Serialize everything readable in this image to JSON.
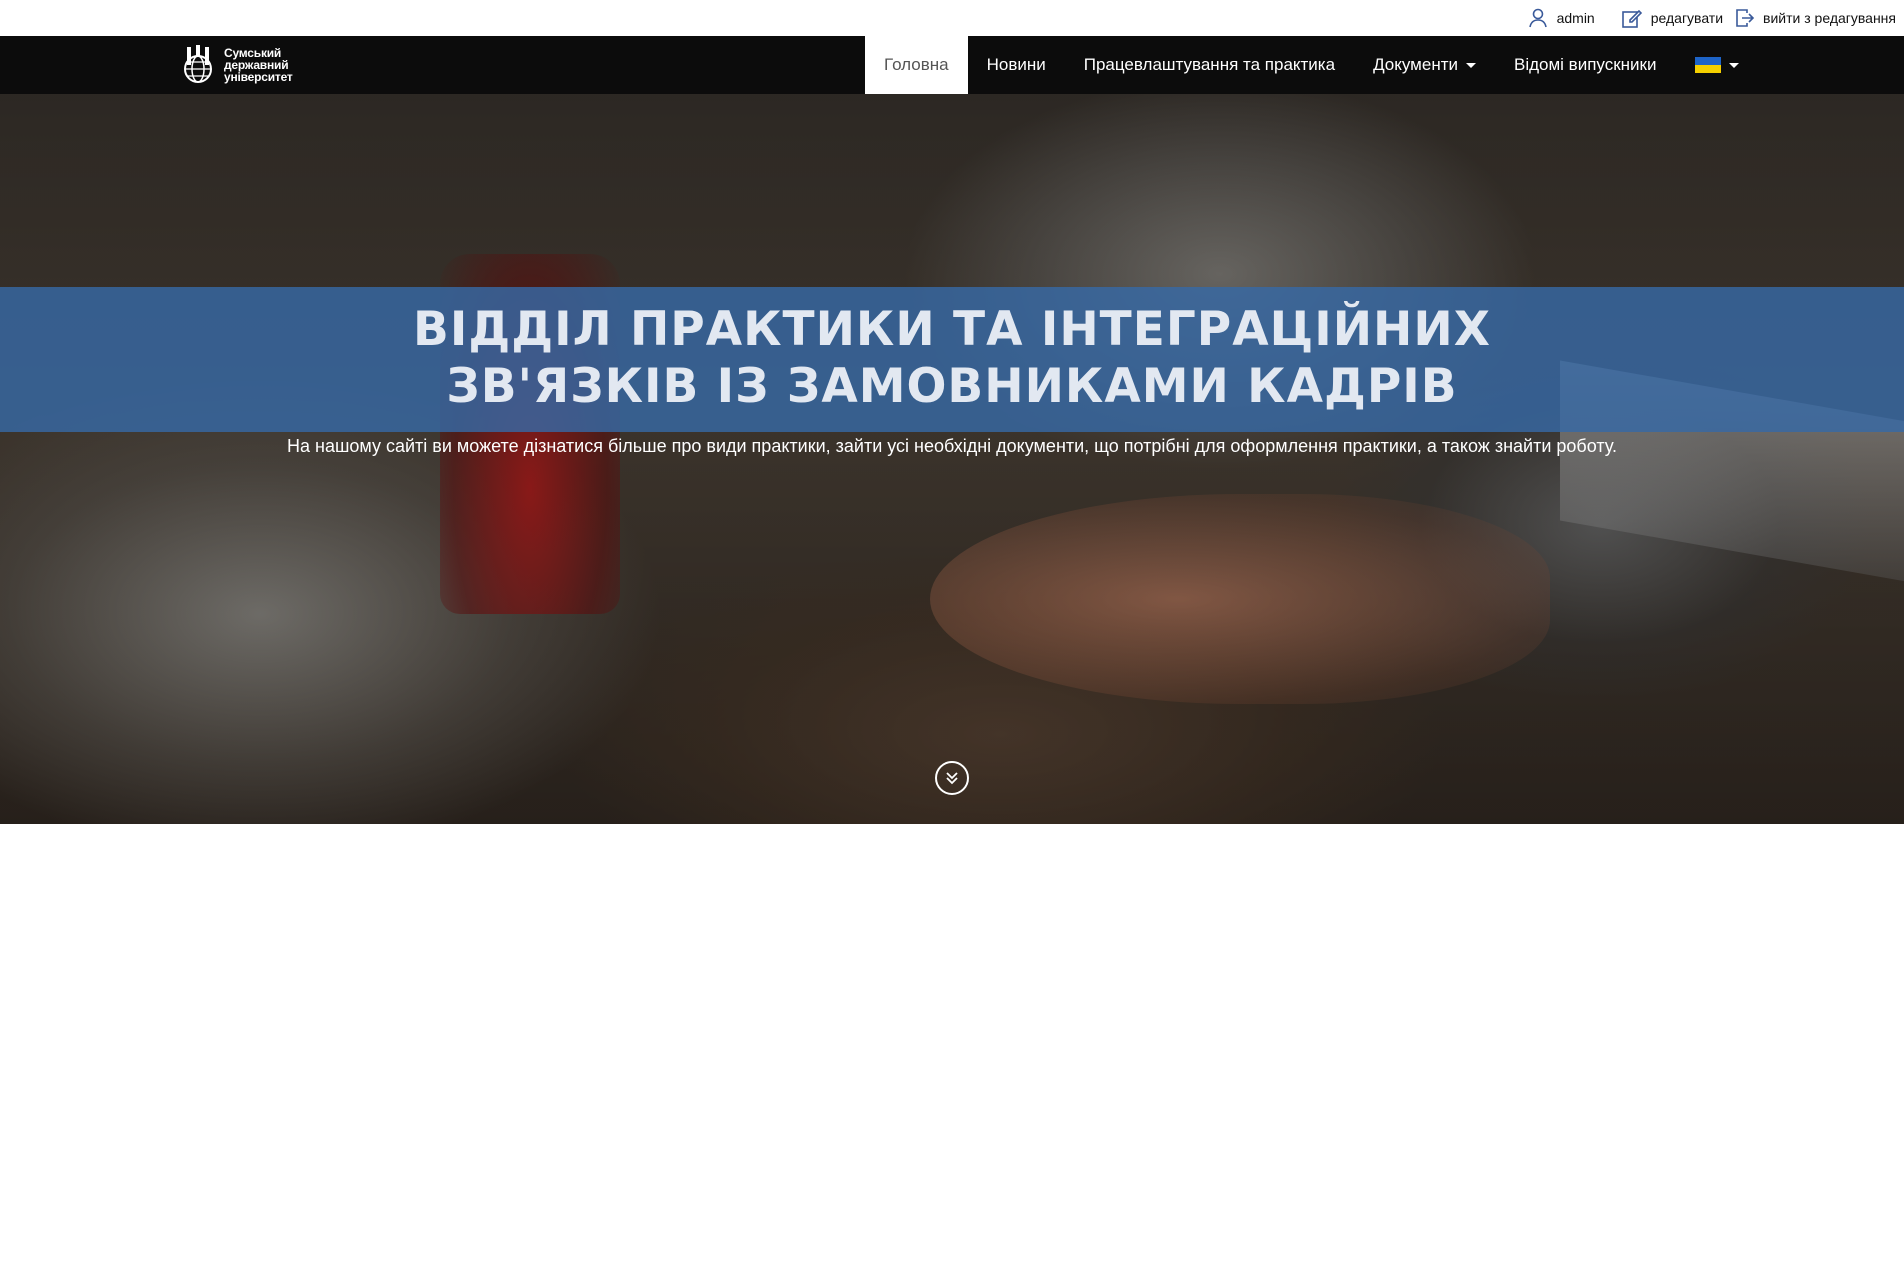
{
  "admin_bar": {
    "user_name": "admin",
    "edit_label": "редагувати",
    "exit_label": "вийти з редагування",
    "user_icon": "user-icon",
    "edit_icon": "edit-icon",
    "exit_icon": "exit-icon"
  },
  "logo": {
    "lines": [
      "Сумський",
      "державний",
      "університет"
    ]
  },
  "nav": {
    "items": [
      {
        "label": "Головна",
        "active": true
      },
      {
        "label": "Новини"
      },
      {
        "label": "Працевлаштування та практика"
      },
      {
        "label": "Документи",
        "dropdown": true
      },
      {
        "label": "Відомі випускники"
      }
    ],
    "language": {
      "icon": "ukraine-flag-icon",
      "dropdown": true
    }
  },
  "hero": {
    "title_line1": "ВІДДІЛ ПРАКТИКИ ТА ІНТЕГРАЦІЙНИХ",
    "title_line2": "ЗВ'ЯЗКІВ ІЗ ЗАМОВНИКАМИ КАДРІВ",
    "subtitle": "На нашому сайті ви можете дізнатися більше про види практики, зайти усі необхідні документи, що потрібні для оформлення практики, а також знайти роботу.",
    "scroll_icon": "double-chevron-down-icon"
  },
  "colors": {
    "navbar_bg": "#0c0c0c",
    "hero_band": "#3769a5",
    "active_nav_bg": "#ffffff",
    "flag_blue": "#1e64c8",
    "flag_yellow": "#f5d000"
  }
}
